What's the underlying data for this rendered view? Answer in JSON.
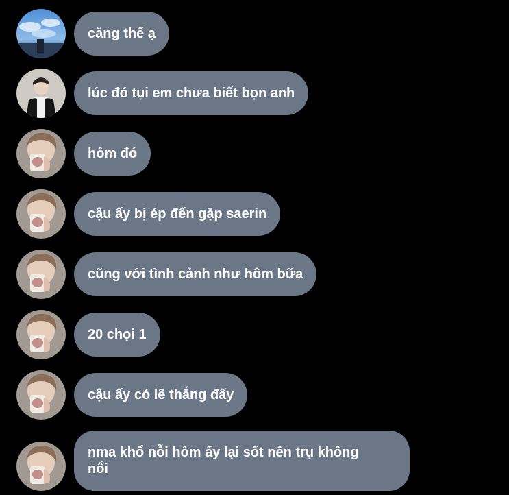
{
  "messages": [
    {
      "text": "căng thế ạ",
      "avatar": "sky-avatar-icon"
    },
    {
      "text": "lúc đó tụi em chưa biết bọn anh",
      "avatar": "person-jacket-avatar-icon"
    },
    {
      "text": "hôm đó",
      "avatar": "person-cup-avatar-icon"
    },
    {
      "text": "cậu ấy bị ép đến gặp saerin",
      "avatar": "person-cup-avatar-icon"
    },
    {
      "text": "cũng với tình cảnh như hôm bữa",
      "avatar": "person-cup-avatar-icon"
    },
    {
      "text": "20 chọi 1",
      "avatar": "person-cup-avatar-icon"
    },
    {
      "text": "cậu ấy có lẽ thắng đấy",
      "avatar": "person-cup-avatar-icon"
    },
    {
      "text": "nma khổ nỗi hôm ấy lại sốt nên trụ không nổi",
      "avatar": "person-cup-avatar-icon"
    }
  ],
  "colors": {
    "background": "#000000",
    "bubble": "#6b7686",
    "text": "#ffffff"
  }
}
